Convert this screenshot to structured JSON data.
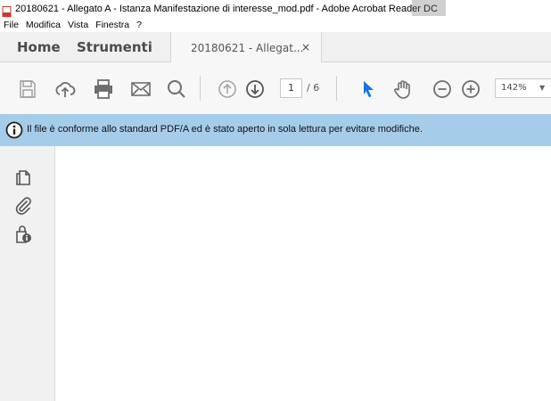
{
  "window": {
    "title": "20180621 - Allegato A - Istanza Manifestazione di interesse_mod.pdf - Adobe Acrobat Reader DC"
  },
  "menu": {
    "items": [
      "File",
      "Modifica",
      "Vista",
      "Finestra",
      "?"
    ]
  },
  "tabs": {
    "home": "Home",
    "tools": "Strumenti",
    "document": "20180621 - Allegat...",
    "close": "×"
  },
  "toolbar": {
    "icons": [
      "save-icon",
      "upload-cloud-icon",
      "print-icon",
      "email-icon",
      "search-icon",
      "page-up-icon",
      "page-down-icon",
      "select-arrow-icon",
      "hand-icon",
      "zoom-out-icon",
      "zoom-in-icon"
    ],
    "current_page": "1",
    "page_total": "/ 6",
    "zoom": "142%",
    "zoom_caret": "▼"
  },
  "infobar": {
    "text": "Il file è conforme allo standard PDF/A ed è stato aperto in sola lettura per evitare modifiche."
  },
  "left_panel": {
    "icons": [
      "pages-icon",
      "attachment-icon",
      "lock-document-icon"
    ]
  },
  "colors": {
    "infobar_bg": "#a5cde9",
    "accent_blue": "#1473e6",
    "icon_gray": "#6e6e6e"
  }
}
